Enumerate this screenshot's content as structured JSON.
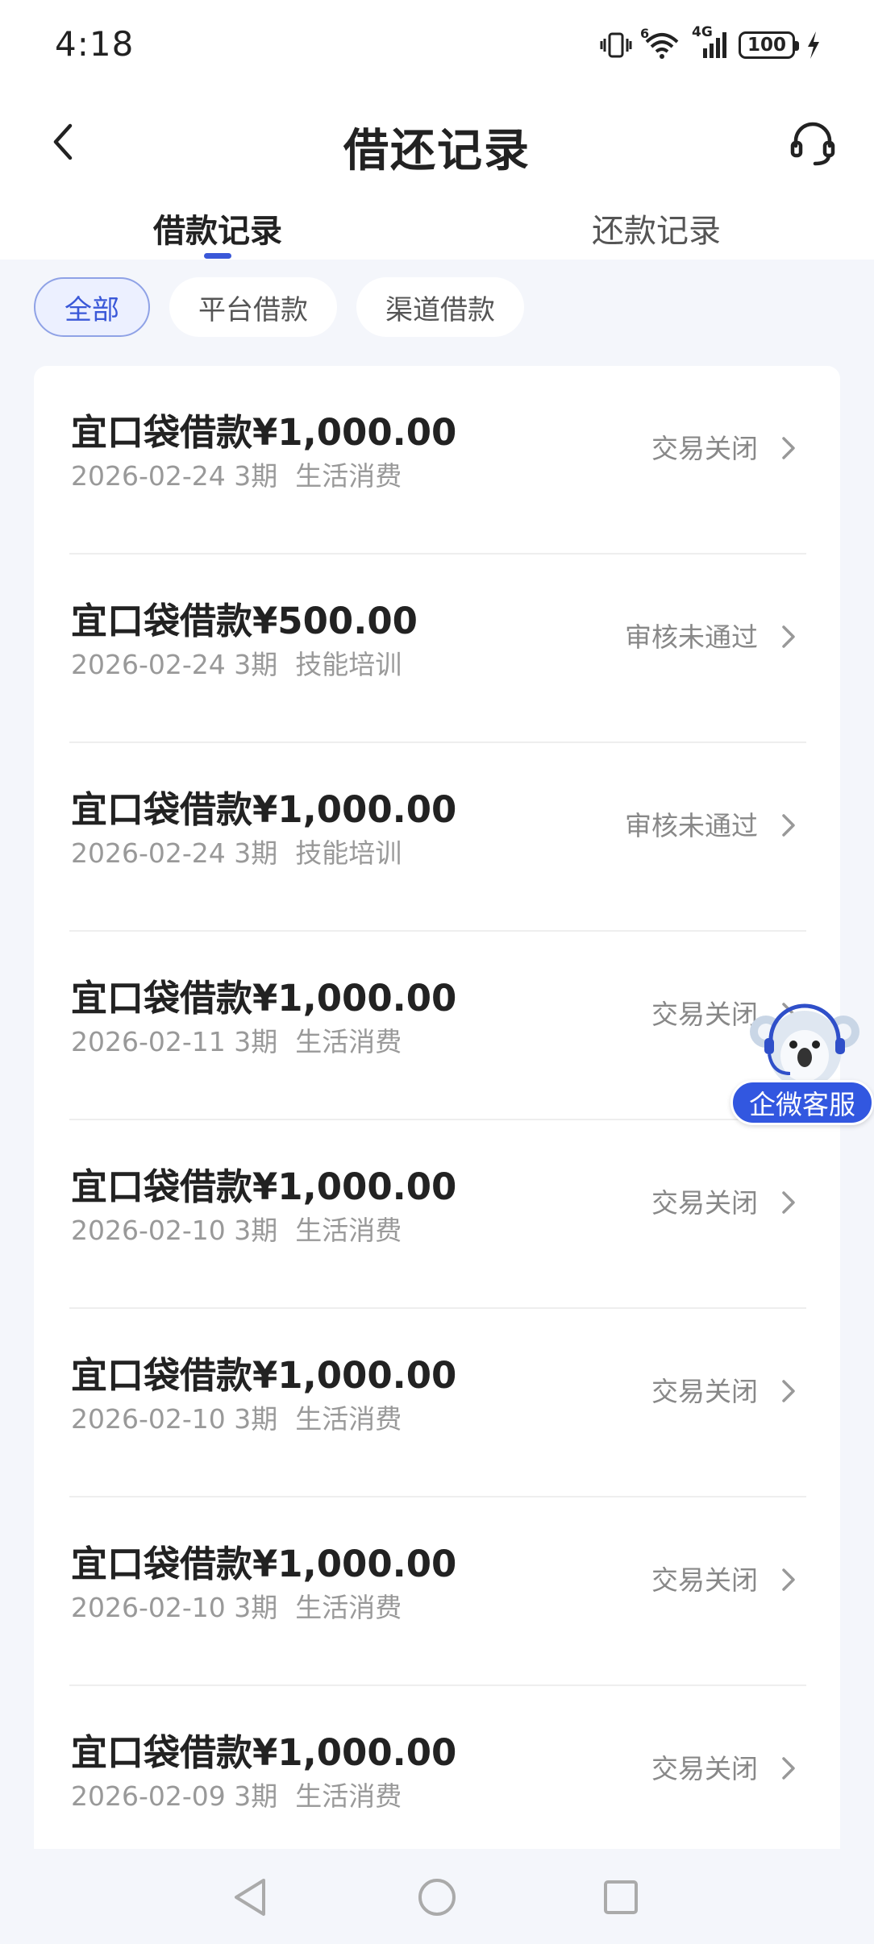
{
  "status_bar": {
    "time": "4:18",
    "network": "4G",
    "wifi_label": "6",
    "battery": "100"
  },
  "nav": {
    "title": "借还记录",
    "back_icon": "chevron-left-icon",
    "service_icon": "headset-icon"
  },
  "tabs": [
    {
      "label": "借款记录",
      "active": true
    },
    {
      "label": "还款记录",
      "active": false
    }
  ],
  "filters": [
    {
      "label": "全部",
      "active": true
    },
    {
      "label": "平台借款",
      "active": false
    },
    {
      "label": "渠道借款",
      "active": false
    }
  ],
  "records": [
    {
      "title": "宜口袋借款¥1,000.00",
      "date": "2026-02-24",
      "term": "3期",
      "purpose": "生活消费",
      "status": "交易关闭"
    },
    {
      "title": "宜口袋借款¥500.00",
      "date": "2026-02-24",
      "term": "3期",
      "purpose": "技能培训",
      "status": "审核未通过"
    },
    {
      "title": "宜口袋借款¥1,000.00",
      "date": "2026-02-24",
      "term": "3期",
      "purpose": "技能培训",
      "status": "审核未通过"
    },
    {
      "title": "宜口袋借款¥1,000.00",
      "date": "2026-02-11",
      "term": "3期",
      "purpose": "生活消费",
      "status": "交易关闭"
    },
    {
      "title": "宜口袋借款¥1,000.00",
      "date": "2026-02-10",
      "term": "3期",
      "purpose": "生活消费",
      "status": "交易关闭"
    },
    {
      "title": "宜口袋借款¥1,000.00",
      "date": "2026-02-10",
      "term": "3期",
      "purpose": "生活消费",
      "status": "交易关闭"
    },
    {
      "title": "宜口袋借款¥1,000.00",
      "date": "2026-02-10",
      "term": "3期",
      "purpose": "生活消费",
      "status": "交易关闭"
    },
    {
      "title": "宜口袋借款¥1,000.00",
      "date": "2026-02-09",
      "term": "3期",
      "purpose": "生活消费",
      "status": "交易关闭"
    }
  ],
  "float_service": {
    "label": "企微客服",
    "icon": "koala-mascot-icon"
  },
  "colors": {
    "accent": "#3a58d8",
    "float_button": "#3257e0",
    "background": "#f4f6fb"
  }
}
